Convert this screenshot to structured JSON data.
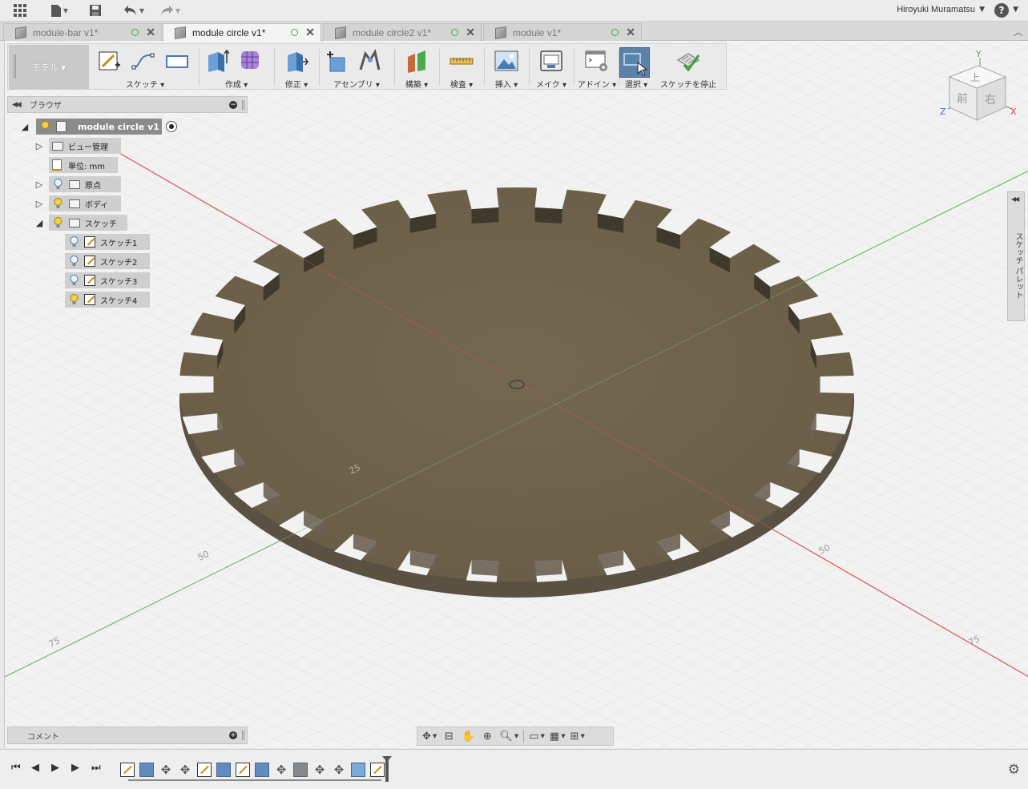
{
  "topbar": {
    "icons": [
      "apps-grid-icon",
      "file-menu-icon",
      "save-icon",
      "undo-icon",
      "redo-icon"
    ],
    "user": "Hiroyuki Muramatsu",
    "help": "?"
  },
  "tabs": [
    {
      "label": "module-bar v1*",
      "active": false
    },
    {
      "label": "module circle v1*",
      "active": true
    },
    {
      "label": "module circle2 v1*",
      "active": false
    },
    {
      "label": "module v1*",
      "active": false
    }
  ],
  "toolbar": {
    "workspace": "モデル ▾",
    "groups": [
      {
        "label": "スケッチ ▾",
        "icons": [
          "create-sketch-icon",
          "line-icon",
          "rectangle-icon"
        ]
      },
      {
        "label": "作成 ▾",
        "icons": [
          "extrude-icon",
          "form-icon"
        ]
      },
      {
        "label": "修正 ▾",
        "icons": [
          "press-pull-icon"
        ]
      },
      {
        "label": "アセンブリ ▾",
        "icons": [
          "new-component-icon",
          "joint-icon"
        ]
      },
      {
        "label": "構築 ▾",
        "icons": [
          "offset-plane-icon"
        ]
      },
      {
        "label": "検査 ▾",
        "icons": [
          "measure-icon"
        ]
      },
      {
        "label": "挿入 ▾",
        "icons": [
          "insert-image-icon"
        ]
      },
      {
        "label": "メイク ▾",
        "icons": [
          "3d-print-icon"
        ]
      },
      {
        "label": "アドイン ▾",
        "icons": [
          "scripts-addins-icon"
        ]
      },
      {
        "label": "選択 ▾",
        "icons": [
          "select-icon"
        ]
      },
      {
        "label": "スケッチを停止",
        "icons": [
          "stop-sketch-icon"
        ]
      }
    ]
  },
  "browser": {
    "title": "ブラウザ",
    "root": "module circle v1",
    "items": {
      "view_management": "ビュー管理",
      "units": "単位: mm",
      "origin": "原点",
      "bodies": "ボディ",
      "sketches": "スケッチ"
    },
    "sketches": [
      "スケッチ1",
      "スケッチ2",
      "スケッチ3",
      "スケッチ4"
    ]
  },
  "viewcube": {
    "top": "上",
    "front": "前",
    "right": "右",
    "axis_y": "Y",
    "axis_x": "X",
    "axis_z": "Z"
  },
  "grid_labels": {
    "g25": "25",
    "g50a": "50",
    "g75a": "75",
    "g50b": "50",
    "g75b": "75"
  },
  "comment": {
    "title": "コメント"
  },
  "sketch_palette": {
    "label": "スケッチ パレット"
  },
  "colors": {
    "body": "#6f624d",
    "wall": "#524a3d",
    "x_axis": "#d04545",
    "y_axis": "#52b452",
    "accent": "#5b82a8"
  }
}
